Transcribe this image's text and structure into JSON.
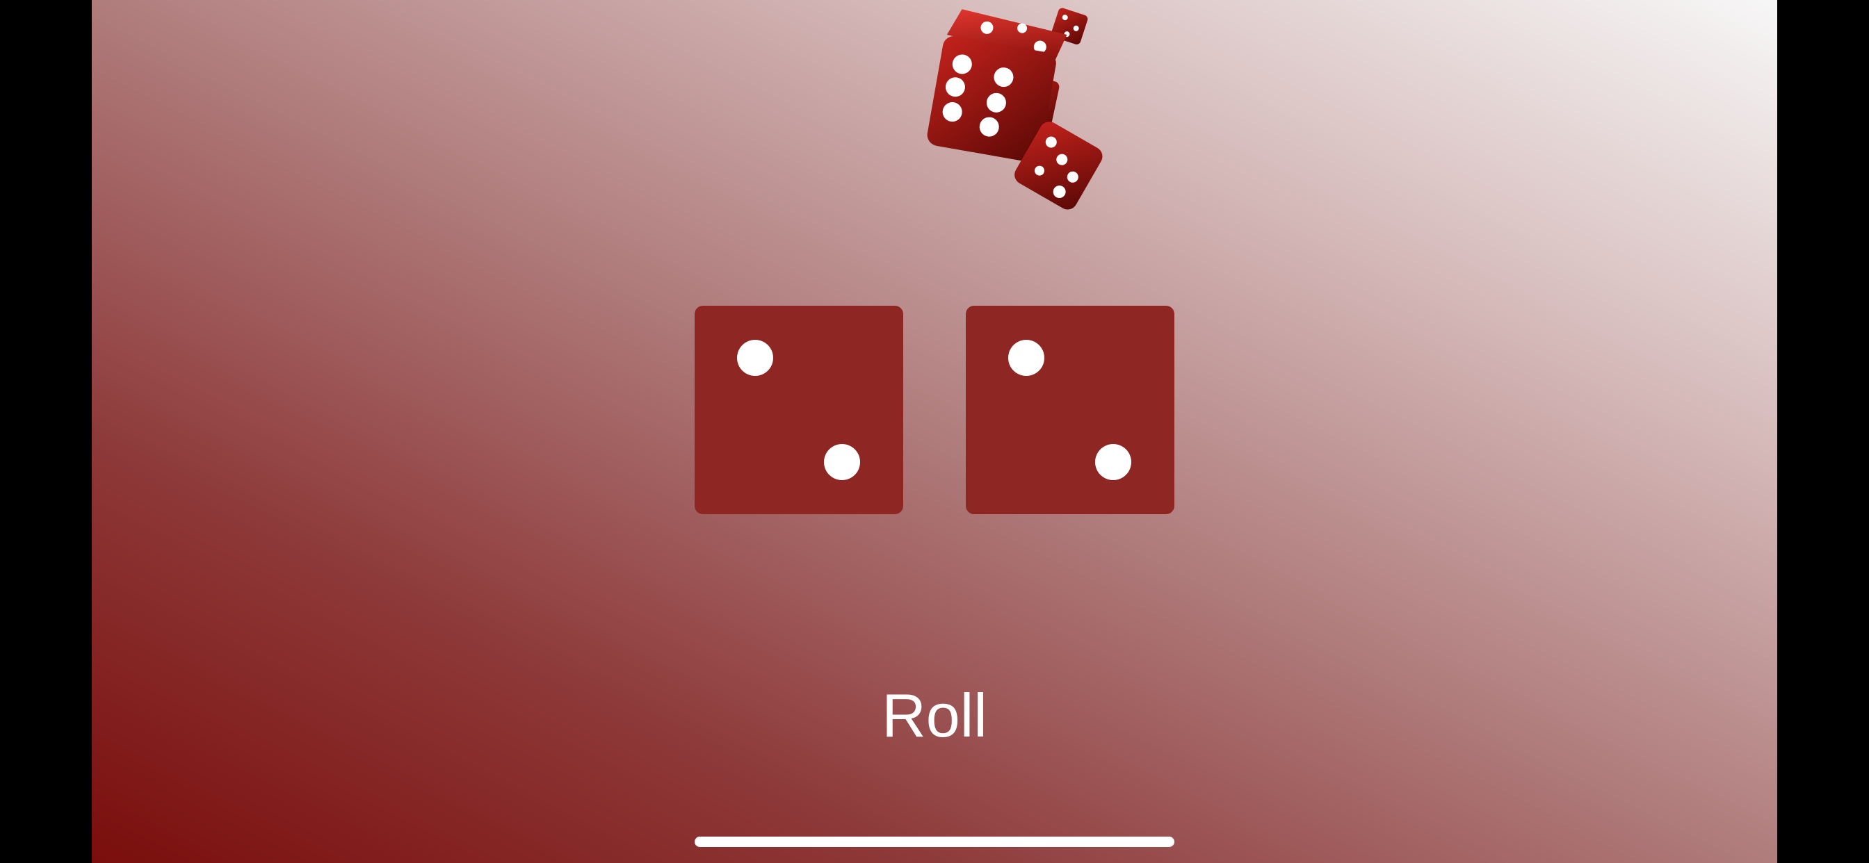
{
  "app": {
    "hero_image": "falling-red-dice-illustration",
    "accent_color": "#8e2623",
    "background_gradient": [
      "#7a0e0c",
      "#f7f7f7"
    ]
  },
  "dice": [
    {
      "label": "left-die",
      "face_value": 2
    },
    {
      "label": "right-die",
      "face_value": 2
    }
  ],
  "actions": {
    "roll_label": "Roll"
  }
}
